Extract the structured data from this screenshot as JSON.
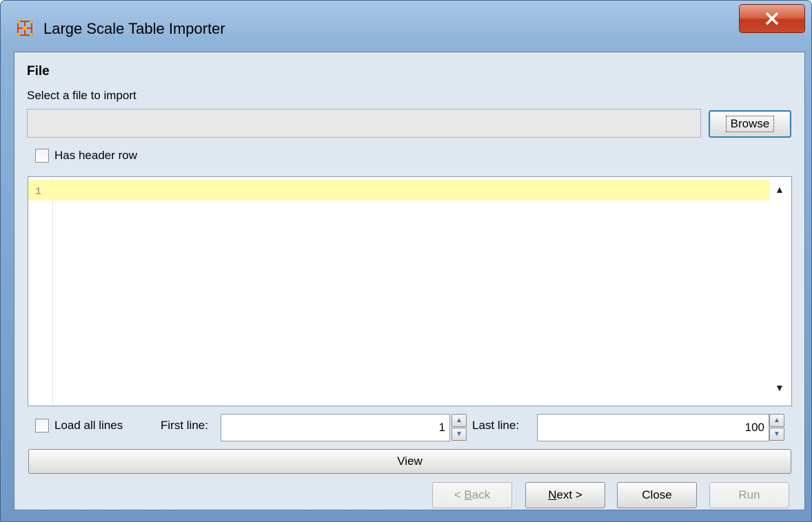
{
  "window": {
    "title": "Large Scale Table Importer",
    "close_glyph": "X"
  },
  "file_section": {
    "title": "File",
    "subtitle": "Select a file to import",
    "file_path_value": "",
    "browse_label": "Browse",
    "has_header_row_label": "Has header row",
    "has_header_row_checked": false
  },
  "editor": {
    "line_numbers": [
      "1"
    ],
    "lines": [
      ""
    ],
    "current_line_color": "#fffbaa"
  },
  "range": {
    "load_all_lines_label": "Load all lines",
    "load_all_lines_checked": false,
    "first_line_label": "First line:",
    "first_line_value": "1",
    "last_line_label": "Last line:",
    "last_line_value": "100"
  },
  "actions": {
    "view_label": "View",
    "back_label": "< Back",
    "back_mnemonic": "B",
    "back_enabled": false,
    "next_label": "Next >",
    "next_mnemonic": "N",
    "close_label": "Close",
    "run_label": "Run",
    "run_enabled": false
  },
  "icons": {
    "app_icon": "network-grid-icon",
    "window_close": "close-icon",
    "scroll_up": "scroll-up-arrow-icon",
    "scroll_down": "scroll-down-arrow-icon",
    "spinner_up": "spinner-up-icon",
    "spinner_down": "spinner-down-icon"
  },
  "colors": {
    "title_close_button": "#c9492c",
    "client_background": "#dfe7f1",
    "focus_border": "#3c7fb1"
  }
}
